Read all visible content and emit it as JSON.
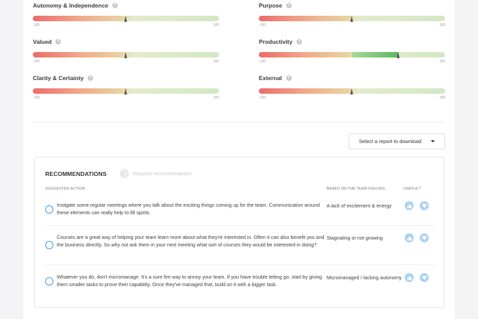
{
  "gauges": [
    {
      "title": "Autonomy & Independence",
      "min": "-100",
      "max": "100",
      "value": 0,
      "fill": null
    },
    {
      "title": "Purpose",
      "min": "-100",
      "max": "100",
      "value": 0,
      "fill": null
    },
    {
      "title": "Valued",
      "min": "-100",
      "max": "100",
      "value": 0,
      "fill": null
    },
    {
      "title": "Productivity",
      "min": "-100",
      "max": "100",
      "value": 50,
      "fill": "#5cb85c"
    },
    {
      "title": "Clarity & Certainty",
      "min": "-100",
      "max": "100",
      "value": 0,
      "fill": null
    },
    {
      "title": "External",
      "min": "-100",
      "max": "100",
      "value": 0,
      "fill": null
    }
  ],
  "help_label": "?",
  "report_select": {
    "selected": "Select a report to download"
  },
  "recommendations": {
    "title": "RECOMMENDATIONS",
    "request_label": "Request recommendation",
    "columns": {
      "action": "SUGGESTED ACTION",
      "feeling": "BASED ON THE TEAM FEELING",
      "useful": "USEFUL?"
    },
    "rows": [
      {
        "action": "Instigate some regular meetings where you talk about the exciting things coming up for the team. Communication around these elements can really help to lift spirits.",
        "feeling": "A lack of excitement & energy"
      },
      {
        "action": "Courses are a great way of helping your team learn more about what they're interested in. Often it can also benefit you and the business directly. So why not ask them in your next meeting what sort of courses they would be interested in doing?",
        "feeling": "Stagnating or not growing"
      },
      {
        "action": "Whatever you do, don't micromanage. It's a sure fire way to annoy your team. If you have trouble letting go, start by giving them smaller tasks to prove their capability. Once they've managed that, build on it with a bigger task.",
        "feeling": "Micromanaged / lacking autonomy"
      }
    ]
  },
  "colors": {
    "accent": "#3b9be0",
    "vote_bg": "#a9d0f2",
    "productivity_fill": "#5cb85c"
  },
  "icons": {
    "thumbs_up": "thumbs-up-icon",
    "thumbs_down": "thumbs-down-icon",
    "request": "check-circle-icon",
    "caret": "caret-down-icon"
  }
}
